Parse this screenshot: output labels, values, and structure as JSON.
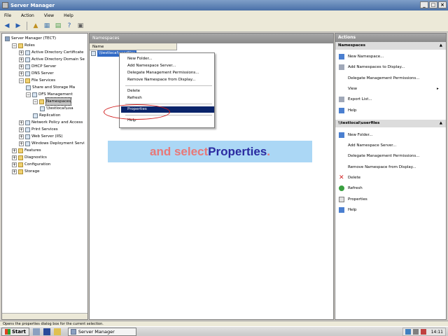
{
  "window": {
    "title": "Server Manager"
  },
  "menu": [
    "File",
    "Action",
    "View",
    "Help"
  ],
  "toolbar": [
    "back-icon",
    "forward-icon",
    "up-icon",
    "show-hide-tree-icon",
    "export-icon",
    "help-icon",
    "properties-icon"
  ],
  "tree": [
    {
      "label": "Server Manager (TECT)",
      "level": 0,
      "expander": "",
      "icon": "server"
    },
    {
      "label": "Roles",
      "level": 1,
      "expander": "−",
      "icon": "folder"
    },
    {
      "label": "Active Directory Certificate",
      "level": 2,
      "expander": "+",
      "icon": "node"
    },
    {
      "label": "Active Directory Domain Se",
      "level": 2,
      "expander": "+",
      "icon": "node"
    },
    {
      "label": "DHCP Server",
      "level": 2,
      "expander": "+",
      "icon": "node"
    },
    {
      "label": "DNS Server",
      "level": 2,
      "expander": "+",
      "icon": "node"
    },
    {
      "label": "File Services",
      "level": 2,
      "expander": "−",
      "icon": "folder"
    },
    {
      "label": "Share and Storage Ma",
      "level": 3,
      "expander": "",
      "icon": "node"
    },
    {
      "label": "DFS Management",
      "level": 3,
      "expander": "−",
      "icon": "node"
    },
    {
      "label": "Namespaces",
      "level": 4,
      "expander": "−",
      "icon": "folder",
      "selected": true
    },
    {
      "label": "\\\\testlocal\\usa",
      "level": 5,
      "expander": "",
      "icon": "node"
    },
    {
      "label": "Replication",
      "level": 4,
      "expander": "",
      "icon": "node"
    },
    {
      "label": "Network Policy and Access",
      "level": 2,
      "expander": "+",
      "icon": "node"
    },
    {
      "label": "Print Services",
      "level": 2,
      "expander": "+",
      "icon": "node"
    },
    {
      "label": "Web Server (IIS)",
      "level": 2,
      "expander": "+",
      "icon": "node"
    },
    {
      "label": "Windows Deployment Servi",
      "level": 2,
      "expander": "+",
      "icon": "node"
    },
    {
      "label": "Features",
      "level": 1,
      "expander": "+",
      "icon": "folder"
    },
    {
      "label": "Diagnostics",
      "level": 1,
      "expander": "+",
      "icon": "folder"
    },
    {
      "label": "Configuration",
      "level": 1,
      "expander": "+",
      "icon": "folder"
    },
    {
      "label": "Storage",
      "level": 1,
      "expander": "+",
      "icon": "folder"
    }
  ],
  "center": {
    "header": "Namespaces",
    "column_name": "Name",
    "row_label": "\\\\testlocal\\userfiles"
  },
  "context_menu": [
    {
      "label": "New Folder...",
      "group": 0
    },
    {
      "label": "Add Namespace Server...",
      "group": 0
    },
    {
      "label": "Delegate Management Permissions...",
      "group": 0
    },
    {
      "label": "Remove Namespace from Display...",
      "group": 0
    },
    {
      "label": "Delete",
      "group": 1
    },
    {
      "label": "Refresh",
      "group": 1
    },
    {
      "label": "Properties",
      "group": 2,
      "highlighted": true
    },
    {
      "label": "Help",
      "group": 3
    }
  ],
  "caption": {
    "part1": "and select ",
    "part2": "Properties",
    "part3": "."
  },
  "actions": {
    "title": "Actions",
    "section1": "Namespaces",
    "section1_items": [
      {
        "label": "New Namespace...",
        "icon": "blue"
      },
      {
        "label": "Add Namespaces to Display...",
        "icon": "gray"
      },
      {
        "label": "Delegate Management Permissions...",
        "icon": "blank"
      },
      {
        "label": "View",
        "icon": "blank",
        "submenu": true
      },
      {
        "label": "Export List...",
        "icon": "gray"
      },
      {
        "label": "Help",
        "icon": "blue"
      }
    ],
    "section2": "\\\\testlocal\\userfiles",
    "section2_items": [
      {
        "label": "New Folder...",
        "icon": "blue"
      },
      {
        "label": "Add Namespace Server...",
        "icon": "blank"
      },
      {
        "label": "Delegate Management Permissions...",
        "icon": "blank"
      },
      {
        "label": "Remove Namespace from Display...",
        "icon": "blank"
      },
      {
        "label": "Delete",
        "icon": "red"
      },
      {
        "label": "Refresh",
        "icon": "green"
      },
      {
        "label": "Properties",
        "icon": "prop"
      },
      {
        "label": "Help",
        "icon": "blue"
      }
    ]
  },
  "status_text": "Opens the properties dialog box for the current selection.",
  "taskbar": {
    "start": "Start",
    "task": "Server Manager",
    "clock": "14:11"
  }
}
